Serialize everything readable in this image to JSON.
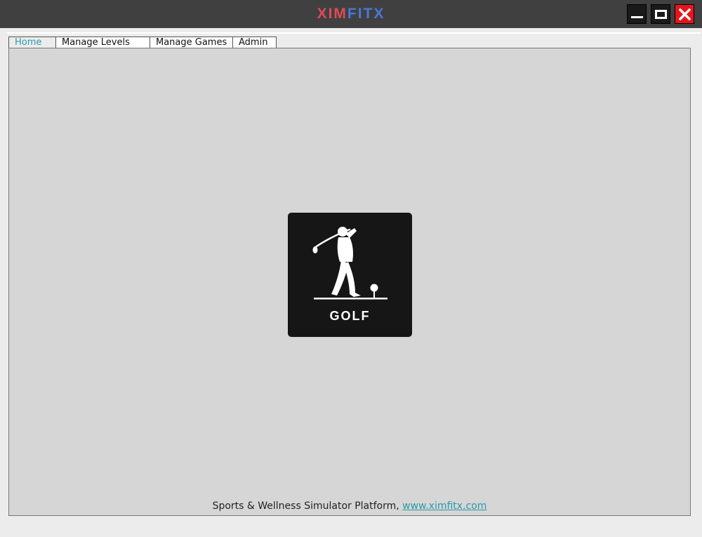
{
  "titlebar": {
    "logo_part1": "XIM",
    "logo_part2": "FITX",
    "logo_color1": "#e04a55",
    "logo_color2": "#4a78d6",
    "minimize_icon": "minimize-icon",
    "maximize_icon": "maximize-icon",
    "close_icon": "close-icon"
  },
  "tabs": [
    {
      "label": "Home",
      "active": true
    },
    {
      "label": "Manage Levels",
      "active": false
    },
    {
      "label": "Manage Games",
      "active": false
    },
    {
      "label": "Admin",
      "active": false
    }
  ],
  "main": {
    "game_tile": {
      "label": "GOLF",
      "icon": "golfer-icon"
    }
  },
  "footer": {
    "text": "Sports & Wellness Simulator Platform, ",
    "link": "www.ximfitx.com",
    "link_color": "#2a9aa8"
  }
}
